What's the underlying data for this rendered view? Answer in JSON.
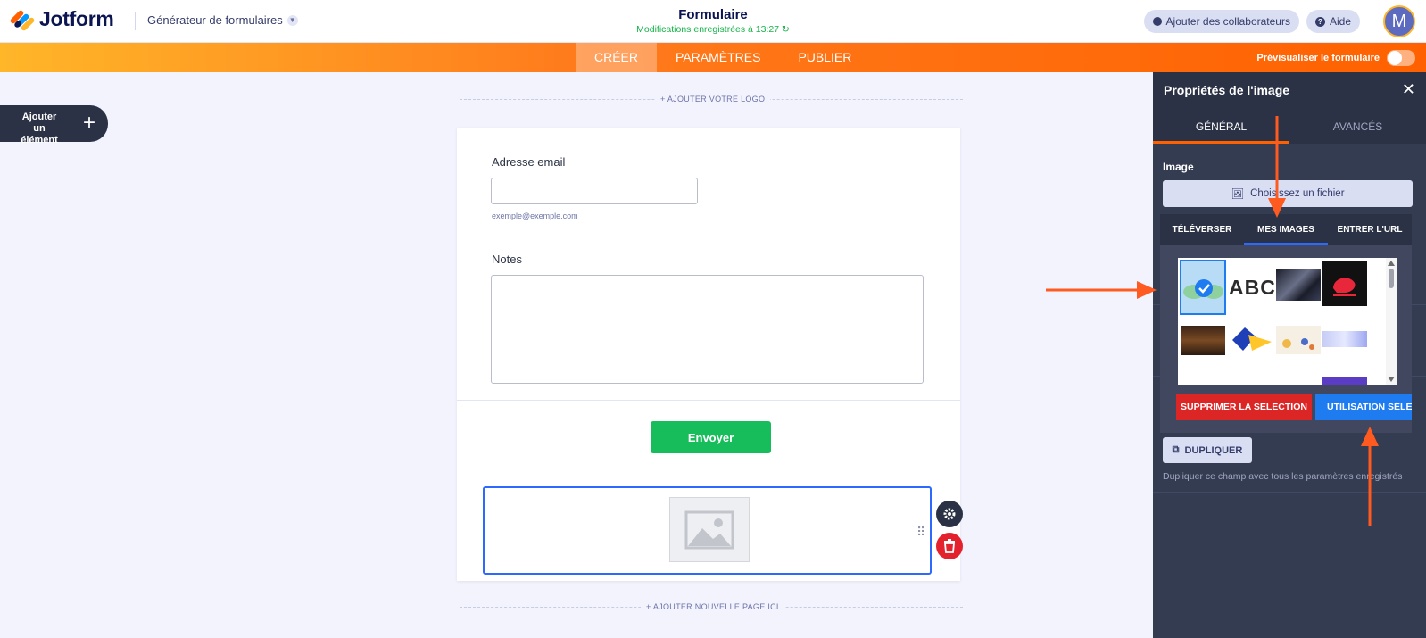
{
  "header": {
    "logo_text": "Jotform",
    "builder_menu": "Générateur de formulaires",
    "form_title": "Formulaire",
    "save_status": "Modifications enregistrées à 13:27",
    "collab_label": "Ajouter des collaborateurs",
    "help_label": "Aide",
    "avatar_letter": "M"
  },
  "nav": {
    "tabs": [
      {
        "label": "CRÉER",
        "active": true
      },
      {
        "label": "PARAMÈTRES",
        "active": false
      },
      {
        "label": "PUBLIER",
        "active": false
      }
    ],
    "preview_label": "Prévisualiser le formulaire"
  },
  "sidebar": {
    "add_element_label": "Ajouter un élément",
    "add_icon": "plus-icon"
  },
  "form": {
    "add_logo": "+ AJOUTER VOTRE LOGO",
    "email_label": "Adresse email",
    "email_value": "",
    "email_sublabel": "exemple@exemple.com",
    "notes_label": "Notes",
    "notes_value": "",
    "submit_label": "Envoyer",
    "add_page": "+ AJOUTER NOUVELLE PAGE ICI"
  },
  "panel": {
    "title": "Propriétés de l'image",
    "tabs": [
      {
        "label": "GÉNÉRAL",
        "active": true
      },
      {
        "label": "AVANCÉS",
        "active": false
      }
    ],
    "image_section": "Image",
    "choose_file": "Choisissez un fichier",
    "duplicate_label": "DUPLIQUER",
    "duplicate_desc": "Dupliquer ce champ avec tous les paramètres enregistrés"
  },
  "chooser": {
    "tabs": [
      {
        "label": "TÉLÉVERSER",
        "active": false
      },
      {
        "label": "MES IMAGES",
        "active": true
      },
      {
        "label": "ENTRER L'URL",
        "active": false
      }
    ],
    "thumbnails": [
      "logo-clouds",
      "abc-text",
      "dark-abstract",
      "red-bird-logo",
      "food-photo",
      "blue-yellow-shape",
      "illustration",
      "webpage-banner",
      "purple-tile"
    ],
    "selected_index": 0,
    "thumb_abc": "ABC",
    "delete_label": "SUPPRIMER LA SELECTION",
    "use_label": "UTILISATION SÉLECTION"
  },
  "colors": {
    "brand_orange": "#ff6100",
    "brand_blue": "#2e69ff",
    "success_green": "#18bd5b",
    "danger_red": "#dc2626",
    "annotation_arrow": "#ff5a1f"
  }
}
